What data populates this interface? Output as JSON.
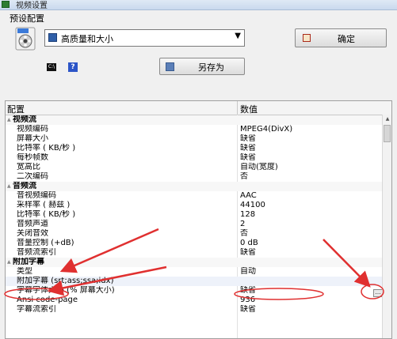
{
  "window": {
    "title": "视频设置"
  },
  "preset": {
    "label": "预设配置",
    "selected": "高质量和大小",
    "ok_label": "确定",
    "save_as_label": "另存为"
  },
  "grid": {
    "headers": {
      "config": "配置",
      "value": "数值"
    },
    "rows": [
      {
        "type": "category",
        "name": "视频流",
        "value": ""
      },
      {
        "type": "item",
        "name": "视频编码",
        "value": "MPEG4(DivX)"
      },
      {
        "type": "item",
        "name": "屏幕大小",
        "value": "缺省"
      },
      {
        "type": "item",
        "name": "比特率 ( KB/秒 )",
        "value": "缺省"
      },
      {
        "type": "item",
        "name": "每秒帧数",
        "value": "缺省"
      },
      {
        "type": "item",
        "name": "宽高比",
        "value": "自动(宽度)"
      },
      {
        "type": "item",
        "name": "二次编码",
        "value": "否"
      },
      {
        "type": "category",
        "name": "音频流",
        "value": ""
      },
      {
        "type": "item",
        "name": "音视频编码",
        "value": "AAC"
      },
      {
        "type": "item",
        "name": "采样率 ( 赫兹 )",
        "value": "44100"
      },
      {
        "type": "item",
        "name": "比特率 ( KB/秒 )",
        "value": "128"
      },
      {
        "type": "item",
        "name": "音频声道",
        "value": "2"
      },
      {
        "type": "item",
        "name": "关闭音效",
        "value": "否"
      },
      {
        "type": "item",
        "name": "音量控制 (+dB)",
        "value": "0 dB"
      },
      {
        "type": "item",
        "name": "音频流索引",
        "value": "缺省"
      },
      {
        "type": "category",
        "name": "附加字幕",
        "value": ""
      },
      {
        "type": "item",
        "name": "类型",
        "value": "自动"
      },
      {
        "type": "item",
        "name": "附加字幕 (srt;ass;ssa;idx)",
        "value": "",
        "highlight": true
      },
      {
        "type": "item",
        "name": "字幕字体大小 (% 屏幕大小)",
        "value": "缺省"
      },
      {
        "type": "item",
        "name": "Ansi code-page",
        "value": "936"
      },
      {
        "type": "item",
        "name": "字幕流索引",
        "value": "缺省"
      }
    ]
  },
  "annotation_color": "#e03030",
  "icons": {
    "app": "app-icon",
    "preset": "film-reel-icon",
    "select": "profile-icon",
    "chevron": "chevron-down-icon",
    "ok": "confirm-icon",
    "cmd": "command-prompt-icon",
    "help": "help-icon",
    "save": "floppy-disk-icon",
    "browse": "browse-file-icon"
  }
}
